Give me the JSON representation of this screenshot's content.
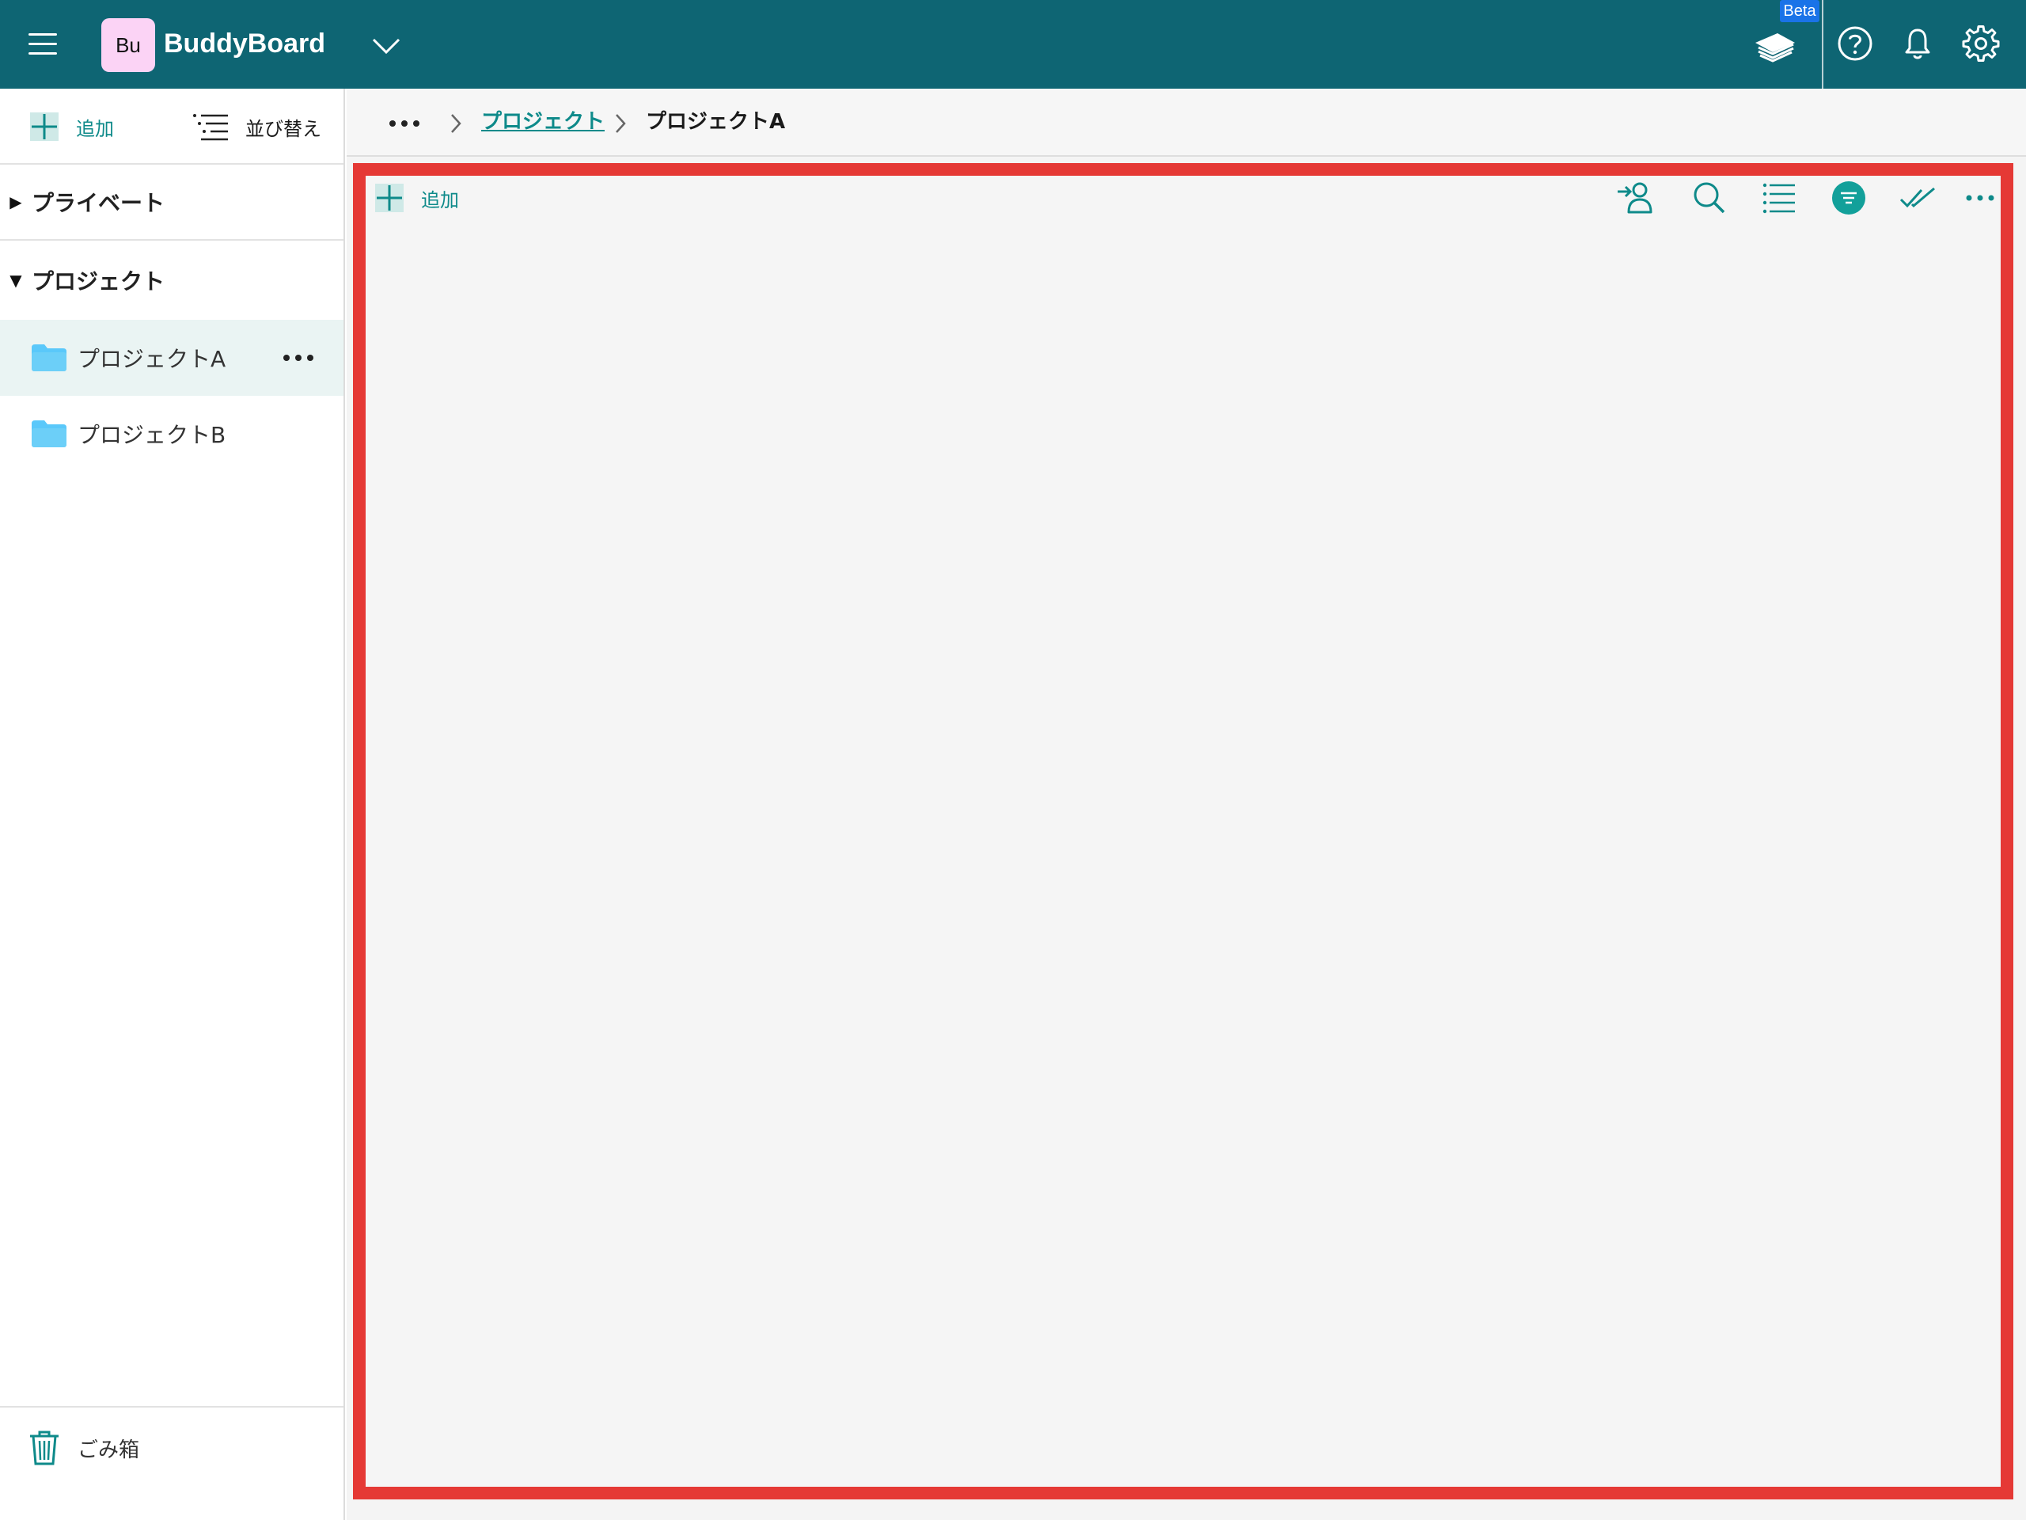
{
  "header": {
    "app_initials": "Bu",
    "app_name": "BuddyBoard",
    "beta_label": "Beta",
    "icons": [
      "menu-icon",
      "chevron-down-icon",
      "academy-icon",
      "help-icon",
      "bell-icon",
      "gear-icon"
    ]
  },
  "sidebar": {
    "add_label": "追加",
    "sort_label": "並び替え",
    "sections": [
      {
        "label": "プライベート",
        "expanded": false,
        "caret": "▶"
      },
      {
        "label": "プロジェクト",
        "expanded": true,
        "caret": "▼"
      }
    ],
    "items": [
      {
        "label": "プロジェクトA",
        "selected": true
      },
      {
        "label": "プロジェクトB",
        "selected": false
      }
    ],
    "trash_label": "ごみ箱"
  },
  "breadcrumb": {
    "link_label": "プロジェクト",
    "current_label": "プロジェクトA"
  },
  "board": {
    "add_label": "追加",
    "toolbar_icons": [
      "assign-member-icon",
      "search-icon",
      "list-view-icon",
      "filter-icon",
      "check-all-icon",
      "more-icon"
    ]
  },
  "colors": {
    "header_bg": "#0e6573",
    "accent": "#0e8a8a",
    "highlight_border": "#e53935",
    "beta_badge": "#1a73e8",
    "folder": "#5ac8fa",
    "selected_item_bg": "#eaf4f3"
  }
}
